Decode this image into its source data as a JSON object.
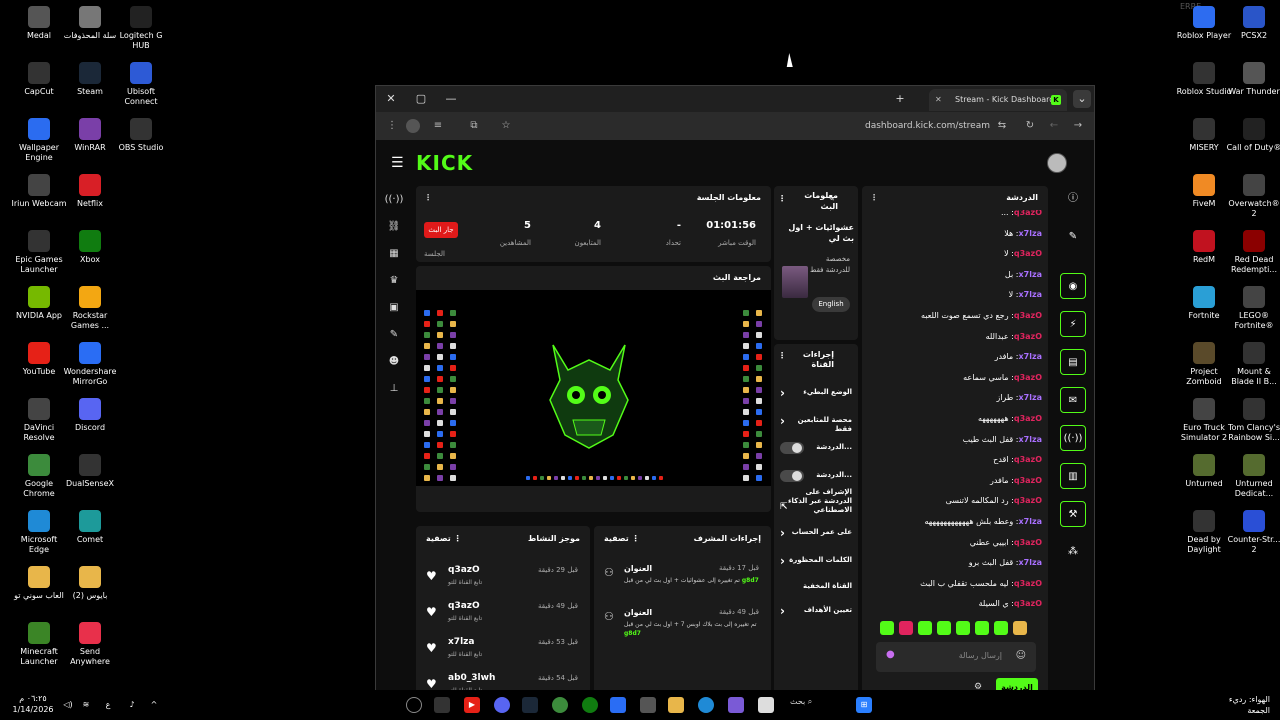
{
  "desktop": {
    "left_icons": [
      {
        "label": "Medal",
        "color": "#555"
      },
      {
        "label": "سلة المحذوفات",
        "color": "#777"
      },
      {
        "label": "Logitech G HUB",
        "color": "#222"
      },
      {
        "label": "CapCut",
        "color": "#333"
      },
      {
        "label": "Steam",
        "color": "#1b2838"
      },
      {
        "label": "Ubisoft Connect",
        "color": "#2d5ad6"
      },
      {
        "label": "Wallpaper Engine",
        "color": "#2b6cf0"
      },
      {
        "label": "WinRAR",
        "color": "#7a3fa8"
      },
      {
        "label": "OBS Studio",
        "color": "#333"
      },
      {
        "label": "Iriun Webcam",
        "color": "#444"
      },
      {
        "label": "Netflix",
        "color": "#d81f26"
      },
      {
        "label": "Epic Games Launcher",
        "color": "#333"
      },
      {
        "label": "Xbox",
        "color": "#107c10"
      },
      {
        "label": "NVIDIA App",
        "color": "#76b900"
      },
      {
        "label": "Rockstar Games ...",
        "color": "#f3a712"
      },
      {
        "label": "YouTube",
        "color": "#e62117"
      },
      {
        "label": "Wondershare MirrorGo",
        "color": "#2a6df4"
      },
      {
        "label": "DaVinci Resolve",
        "color": "#444"
      },
      {
        "label": "Discord",
        "color": "#5865f2"
      },
      {
        "label": "Google Chrome",
        "color": "#3c8b3c"
      },
      {
        "label": "DualSenseX",
        "color": "#333"
      },
      {
        "label": "Microsoft Edge",
        "color": "#1f8ad6"
      },
      {
        "label": "Comet",
        "color": "#1d9a9a"
      },
      {
        "label": "العاب سوني تو",
        "color": "#e8b64a"
      },
      {
        "label": "(2) بايوس",
        "color": "#e8b64a"
      },
      {
        "label": "Minecraft Launcher",
        "color": "#3b8526"
      },
      {
        "label": "Send Anywhere",
        "color": "#e8304b"
      }
    ],
    "right_icons": [
      {
        "label": "Roblox Player",
        "color": "#2d6cf0"
      },
      {
        "label": "PCSX2",
        "color": "#2a55c8"
      },
      {
        "label": "Roblox Studio",
        "color": "#333"
      },
      {
        "label": "War Thunder",
        "color": "#555"
      },
      {
        "label": "MISERY",
        "color": "#333"
      },
      {
        "label": "Call of Duty®",
        "color": "#222"
      },
      {
        "label": "FiveM",
        "color": "#f08a24"
      },
      {
        "label": "Overwatch® 2",
        "color": "#444"
      },
      {
        "label": "RedM",
        "color": "#c1121f"
      },
      {
        "label": "Red Dead Redempti...",
        "color": "#8b0000"
      },
      {
        "label": "Fortnite",
        "color": "#2a9fd6"
      },
      {
        "label": "LEGO® Fortnite®",
        "color": "#444"
      },
      {
        "label": "Project Zomboid",
        "color": "#5a4a2a"
      },
      {
        "label": "Mount & Blade II B...",
        "color": "#333"
      },
      {
        "label": "Euro Truck Simulator 2",
        "color": "#444"
      },
      {
        "label": "Tom Clancy's Rainbow Si...",
        "color": "#333"
      },
      {
        "label": "Unturned",
        "color": "#556b2f"
      },
      {
        "label": "Unturned Dedicat...",
        "color": "#556b2f"
      },
      {
        "label": "Dead by Daylight",
        "color": "#333"
      },
      {
        "label": "Counter-Str... 2",
        "color": "#2a4fd6"
      }
    ],
    "top_right_text": "ERRE"
  },
  "browser": {
    "tab_title": "Stream - Kick Dashboard",
    "url": "dashboard.kick.com/stream",
    "controls": {
      "close": "✕",
      "maximize": "▢",
      "minimize": "—",
      "new_tab": "+"
    }
  },
  "kick": {
    "logo": "KICK",
    "session": {
      "title": "معلومات الجلسة",
      "live_badge": "جار البث",
      "session_label": "الجلسة",
      "stats": [
        {
          "value": "5",
          "label": "المشاهدين"
        },
        {
          "value": "4",
          "label": "المتابعون"
        },
        {
          "value": "-",
          "label": "تحداد"
        },
        {
          "value": "01:01:56",
          "label": "الوقت مباشر"
        }
      ]
    },
    "preview": {
      "title": "مراجعة البث"
    },
    "info": {
      "title": "معلومات البث",
      "stream_title": "عشوائيات + اول بث لي",
      "category": "مخصصة للدردشة فقط",
      "language": "English"
    },
    "quick_actions": {
      "title": "إجراءات القناة",
      "items": [
        {
          "label": "الوضع البطيء",
          "kind": "chev"
        },
        {
          "label": "محصة للمتابعين فقط",
          "kind": "chev"
        },
        {
          "label": "الدردشة...",
          "kind": "toggle"
        },
        {
          "label": "الدردشة...",
          "kind": "toggle"
        },
        {
          "label": "الإشراف على الدردشة عبر الذكاء الاصطناعي",
          "kind": "ext"
        },
        {
          "label": "على عمر الحساب",
          "kind": "chev"
        },
        {
          "label": "الكلمات المحظورة",
          "kind": "chev"
        },
        {
          "label": "القناة المخفية",
          "kind": "none"
        },
        {
          "label": "تعيين الأهداف",
          "kind": "chev"
        }
      ]
    },
    "activity": {
      "title": "موجز النشاط",
      "filter": "تصفية",
      "rows": [
        {
          "user": "q3azO",
          "sub": "تابع القناة للتو",
          "time": "قبل 29 دقيقة"
        },
        {
          "user": "q3azO",
          "sub": "تابع القناة للتو",
          "time": "قبل 49 دقيقة"
        },
        {
          "user": "x7lza",
          "sub": "تابع القناة للتو",
          "time": "قبل 53 دقيقة"
        },
        {
          "user": "ab0_3lwh",
          "sub": "تابع القناة للتو",
          "time": "قبل 54 دقيقة"
        }
      ]
    },
    "mod": {
      "title": "إجراءات المشرف",
      "filter": "تصفية",
      "rows": [
        {
          "title": "العنوان",
          "text": "تم تغييره إلى عشوائيات + اول بث لي من قبل",
          "user": "g8d7",
          "time": "قبل 17 دقيقة"
        },
        {
          "title": "العنوان",
          "text": "تم تغييره إلى بث بلاك اوبس 7 + اول بث لي من قبل",
          "user": "g8d7",
          "time": "قبل 49 دقيقة"
        }
      ]
    },
    "chat": {
      "title": "الدردشة",
      "messages": [
        {
          "user": "q3azO",
          "text": "...",
          "color": "#e0245e"
        },
        {
          "user": "x7lza",
          "text": "هلا",
          "color": "#a970ff"
        },
        {
          "user": "q3azO",
          "text": "لا",
          "color": "#e0245e"
        },
        {
          "user": "x7lza",
          "text": "بل",
          "color": "#a970ff"
        },
        {
          "user": "x7lza",
          "text": "لا",
          "color": "#a970ff"
        },
        {
          "user": "q3azO",
          "text": "رجع دي تسمع صوت اللعبه",
          "color": "#e0245e"
        },
        {
          "user": "q3azO",
          "text": "عبدالله",
          "color": "#e0245e"
        },
        {
          "user": "x7lza",
          "text": "مافدر",
          "color": "#a970ff"
        },
        {
          "user": "q3azO",
          "text": "ماسي سماعه",
          "color": "#e0245e"
        },
        {
          "user": "x7lza",
          "text": "طراز",
          "color": "#a970ff"
        },
        {
          "user": "q3azO",
          "text": "هههههههه",
          "color": "#e0245e"
        },
        {
          "user": "x7lza",
          "text": "قفل البث طيب",
          "color": "#a970ff"
        },
        {
          "user": "q3azO",
          "text": "اقدح",
          "color": "#e0245e"
        },
        {
          "user": "q3azO",
          "text": "مافدر",
          "color": "#e0245e"
        },
        {
          "user": "q3azO",
          "text": "رد المكالمه لاتنسى",
          "color": "#e0245e"
        },
        {
          "user": "x7lza",
          "text": "وعطه بلش ههههههههههههه",
          "color": "#a970ff"
        },
        {
          "user": "q3azO",
          "text": "ابييي عطني",
          "color": "#e0245e"
        },
        {
          "user": "x7lza",
          "text": "قفل البث برو",
          "color": "#a970ff"
        },
        {
          "user": "q3azO",
          "text": "ليه ملحسب تقفلي ب البث",
          "color": "#e0245e"
        },
        {
          "user": "q3azO",
          "text": "ي السيلة",
          "color": "#e0245e"
        }
      ],
      "input_placeholder": "إرسال رسالة",
      "send_label": "الدردشة"
    }
  },
  "taskbar": {
    "clock_time": "٠٦:٢٥ م",
    "clock_date": "1/14/2026",
    "search": "بحث",
    "weather": "الهواء: رديء",
    "weather_day": "الجمعة",
    "lang": "ع"
  }
}
